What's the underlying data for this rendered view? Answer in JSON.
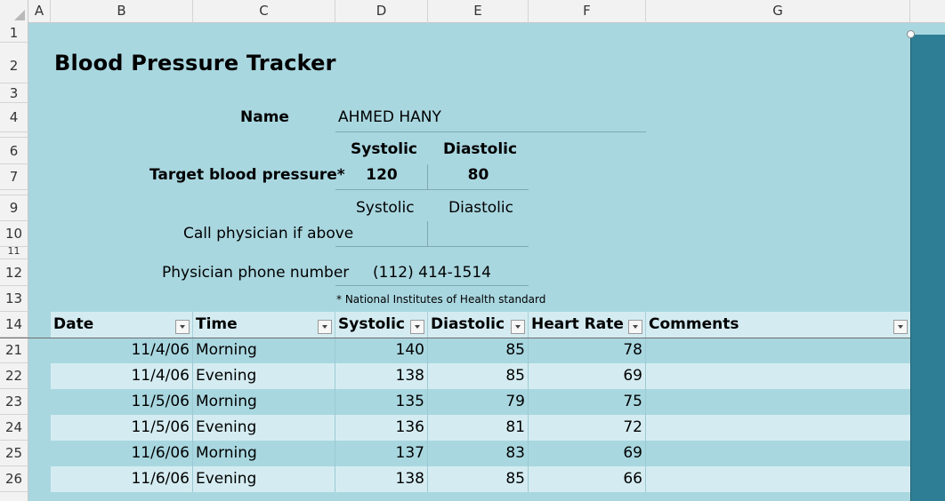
{
  "columns": [
    "A",
    "B",
    "C",
    "D",
    "E",
    "F",
    "G"
  ],
  "rows": [
    "1",
    "2",
    "3",
    "4",
    "6",
    "7",
    "9",
    "10",
    "11",
    "12",
    "13",
    "14",
    "21",
    "22",
    "23",
    "24",
    "25",
    "26"
  ],
  "title": "Blood Pressure Tracker",
  "name_label": "Name",
  "name_value": "AHMED HANY",
  "target": {
    "systolic_header": "Systolic",
    "diastolic_header": "Diastolic",
    "label": "Target blood pressure*",
    "systolic": "120",
    "diastolic": "80"
  },
  "call": {
    "systolic_header": "Systolic",
    "diastolic_header": "Diastolic",
    "label": "Call physician if above",
    "systolic": "",
    "diastolic": ""
  },
  "phone_label": "Physician phone number",
  "phone_value": "(112) 414-1514",
  "footnote": "* National Institutes of Health standard",
  "table": {
    "headers": [
      "Date",
      "Time",
      "Systolic",
      "Diastolic",
      "Heart Rate",
      "Comments"
    ],
    "rows": [
      {
        "date": "11/4/06",
        "time": "Morning",
        "systolic": "140",
        "diastolic": "85",
        "heart_rate": "78",
        "comments": ""
      },
      {
        "date": "11/4/06",
        "time": "Evening",
        "systolic": "138",
        "diastolic": "85",
        "heart_rate": "69",
        "comments": ""
      },
      {
        "date": "11/5/06",
        "time": "Morning",
        "systolic": "135",
        "diastolic": "79",
        "heart_rate": "75",
        "comments": ""
      },
      {
        "date": "11/5/06",
        "time": "Evening",
        "systolic": "136",
        "diastolic": "81",
        "heart_rate": "72",
        "comments": ""
      },
      {
        "date": "11/6/06",
        "time": "Morning",
        "systolic": "137",
        "diastolic": "83",
        "heart_rate": "69",
        "comments": ""
      },
      {
        "date": "11/6/06",
        "time": "Evening",
        "systolic": "138",
        "diastolic": "85",
        "heart_rate": "66",
        "comments": ""
      }
    ]
  },
  "colors": {
    "sheet_bg": "#a9d7e0",
    "band_light": "#d4ecf1",
    "panel": "#2e7f95"
  }
}
